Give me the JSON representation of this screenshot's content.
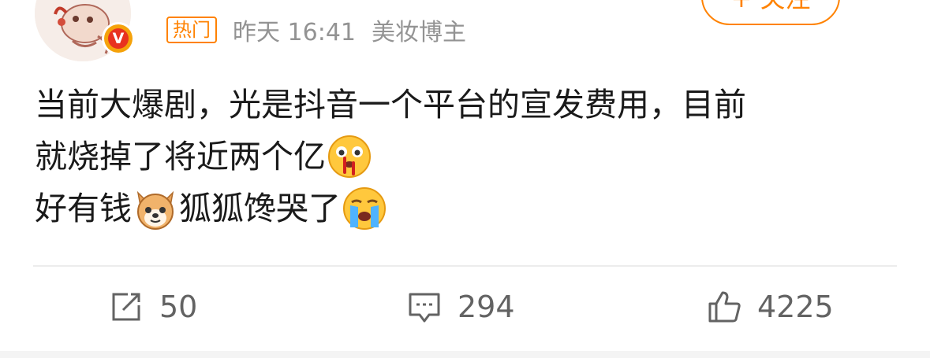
{
  "header": {
    "hot_tag": "热门",
    "time": "昨天 16:41",
    "category": "美妆博主",
    "follow_label": "+ 关注",
    "verified_badge": "V"
  },
  "post": {
    "line1": "当前大爆剧，光是抖音一个平台的宣发费用，目前",
    "line2_text": "就烧掉了将近两个亿",
    "line2_emoji": "nosebleed-emoji",
    "line3_part1": "好有钱",
    "line3_emoji1": "corgi-dog-emoji",
    "line3_part2": "狐狐馋哭了",
    "line3_emoji2": "crying-emoji"
  },
  "actions": {
    "repost_count": "50",
    "comment_count": "294",
    "like_count": "4225"
  },
  "colors": {
    "accent": "#ff8200",
    "meta_gray": "#939393",
    "action_gray": "#636363",
    "text": "#1a1a1a"
  }
}
